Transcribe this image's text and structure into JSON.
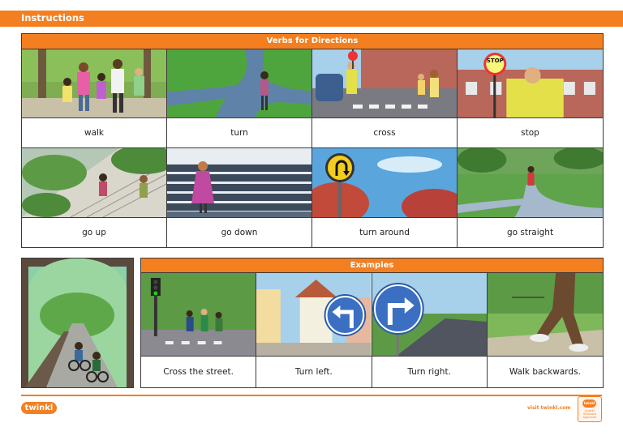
{
  "header": {
    "title": "Instructions"
  },
  "verbs": {
    "title": "Verbs for Directions",
    "items": [
      {
        "label": "walk"
      },
      {
        "label": "turn"
      },
      {
        "label": "cross"
      },
      {
        "label": "stop"
      },
      {
        "label": "go up"
      },
      {
        "label": "go down"
      },
      {
        "label": "turn around"
      },
      {
        "label": "go straight"
      }
    ]
  },
  "examples": {
    "title": "Examples",
    "items": [
      {
        "label": "Cross the street."
      },
      {
        "label": "Turn left."
      },
      {
        "label": "Turn right."
      },
      {
        "label": "Walk backwards."
      }
    ]
  },
  "illustrations": {
    "stop_sign": "STOP"
  },
  "footer": {
    "logo": "twinkl",
    "visit": "visit twinkl.com",
    "badge_logo": "twinkl",
    "badge_text": "Quality Standard Approved"
  },
  "colors": {
    "accent": "#f47f20",
    "border": "#3a3a3a"
  }
}
